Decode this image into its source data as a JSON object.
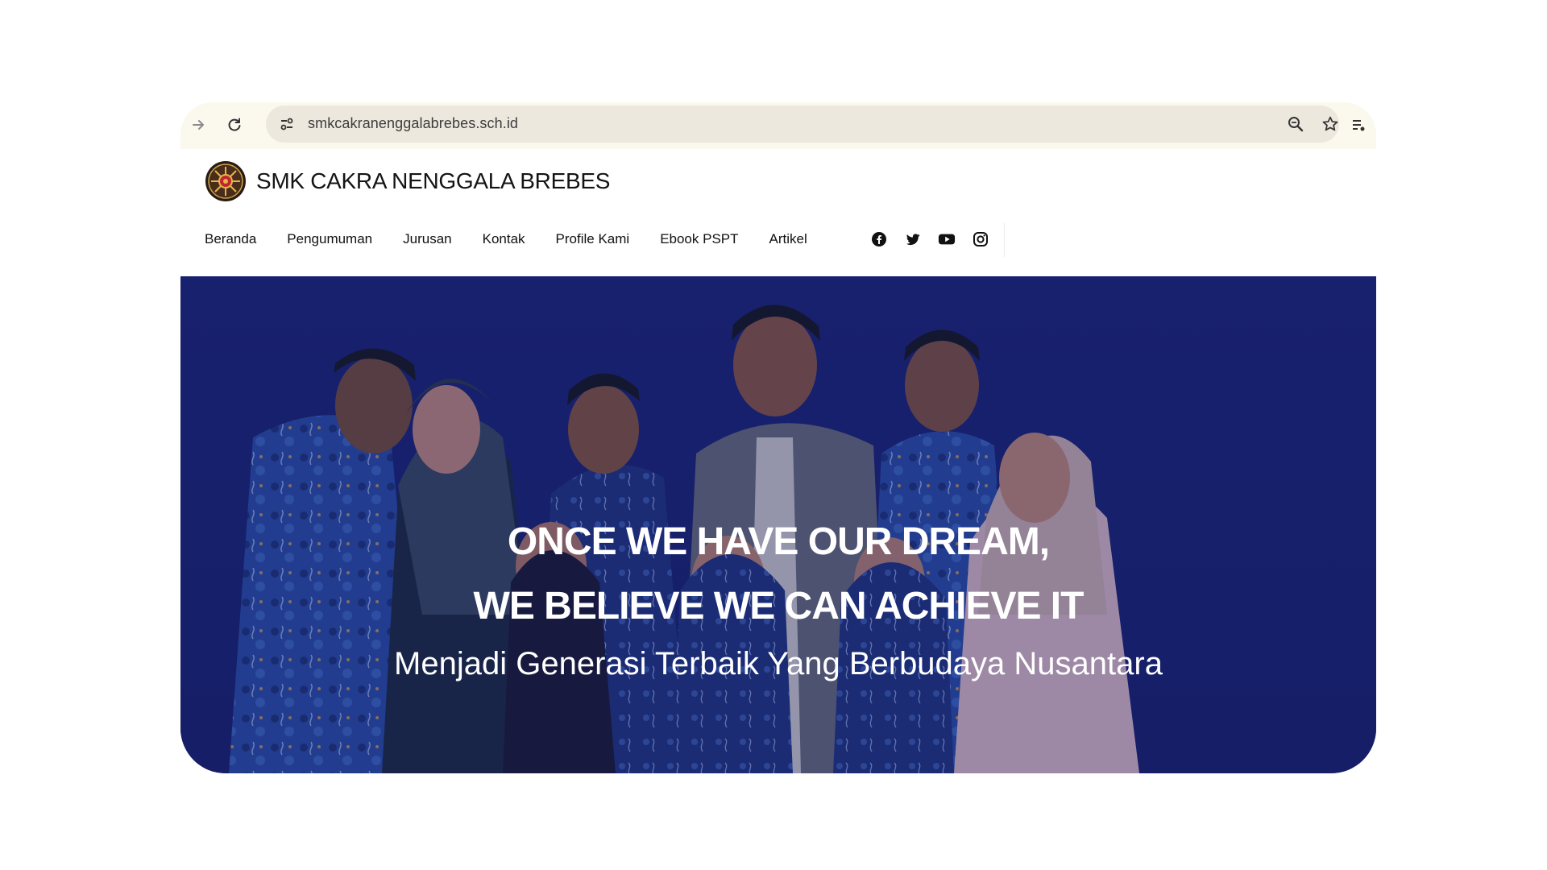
{
  "browser": {
    "url": "smkcakranenggalabrebes.sch.id",
    "icons": [
      "forward-arrow-icon",
      "reload-icon",
      "site-settings-icon",
      "zoom-icon",
      "bookmark-star-icon",
      "reading-list-icon"
    ]
  },
  "site": {
    "title": "SMK CAKRA NENGGALA BREBES",
    "nav": [
      "Beranda",
      "Pengumuman",
      "Jurusan",
      "Kontak",
      "Profile Kami",
      "Ebook PSPT",
      "Artikel"
    ],
    "social": [
      "facebook-icon",
      "twitter-icon",
      "youtube-icon",
      "instagram-icon"
    ]
  },
  "hero": {
    "line1": "ONCE WE HAVE OUR DREAM,",
    "line2": "WE BELIEVE WE CAN ACHIEVE IT",
    "tagline": "Menjadi Generasi Terbaik Yang Berbudaya Nusantara",
    "colors": {
      "background": "#1a2370",
      "batik": "#2a4fa8"
    }
  }
}
